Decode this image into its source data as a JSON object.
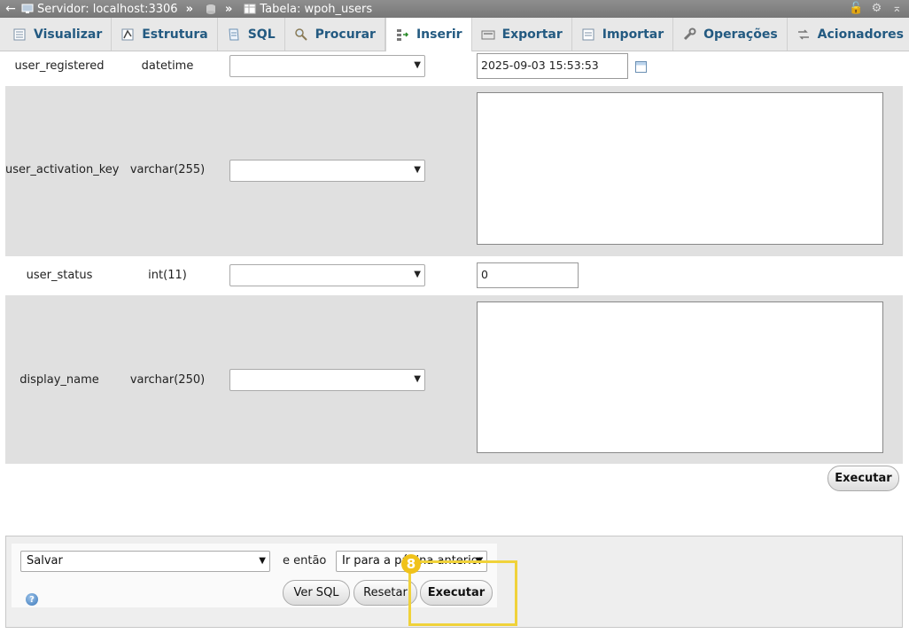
{
  "breadcrumb": {
    "back": "←",
    "server": "Servidor: localhost:3306",
    "table": "Tabela: wpoh_users"
  },
  "tabs": [
    {
      "label": "Visualizar",
      "icon": "browse-icon"
    },
    {
      "label": "Estrutura",
      "icon": "structure-icon"
    },
    {
      "label": "SQL",
      "icon": "sql-icon"
    },
    {
      "label": "Procurar",
      "icon": "search-icon"
    },
    {
      "label": "Inserir",
      "icon": "insert-icon",
      "active": true
    },
    {
      "label": "Exportar",
      "icon": "export-icon"
    },
    {
      "label": "Importar",
      "icon": "import-icon"
    },
    {
      "label": "Operações",
      "icon": "wrench-icon"
    },
    {
      "label": "Acionadores",
      "icon": "triggers-icon"
    }
  ],
  "rows": [
    {
      "name": "user_registered",
      "type": "datetime",
      "value": "2025-09-03 15:53:53"
    },
    {
      "name": "user_activation_key",
      "type": "varchar(255)",
      "value": ""
    },
    {
      "name": "user_status",
      "type": "int(11)",
      "value": "0"
    },
    {
      "name": "display_name",
      "type": "varchar(250)",
      "value": ""
    }
  ],
  "executar_label": "Executar",
  "bottom": {
    "action_select": "Salvar",
    "then_label": "e então",
    "after_select": "Ir para a página anterior",
    "ver_sql": "Ver SQL",
    "resetar": "Resetar",
    "executar": "Executar"
  },
  "highlight_badge": "8",
  "colors": {
    "tab_text": "#235a81",
    "highlight": "#f0d23a"
  }
}
